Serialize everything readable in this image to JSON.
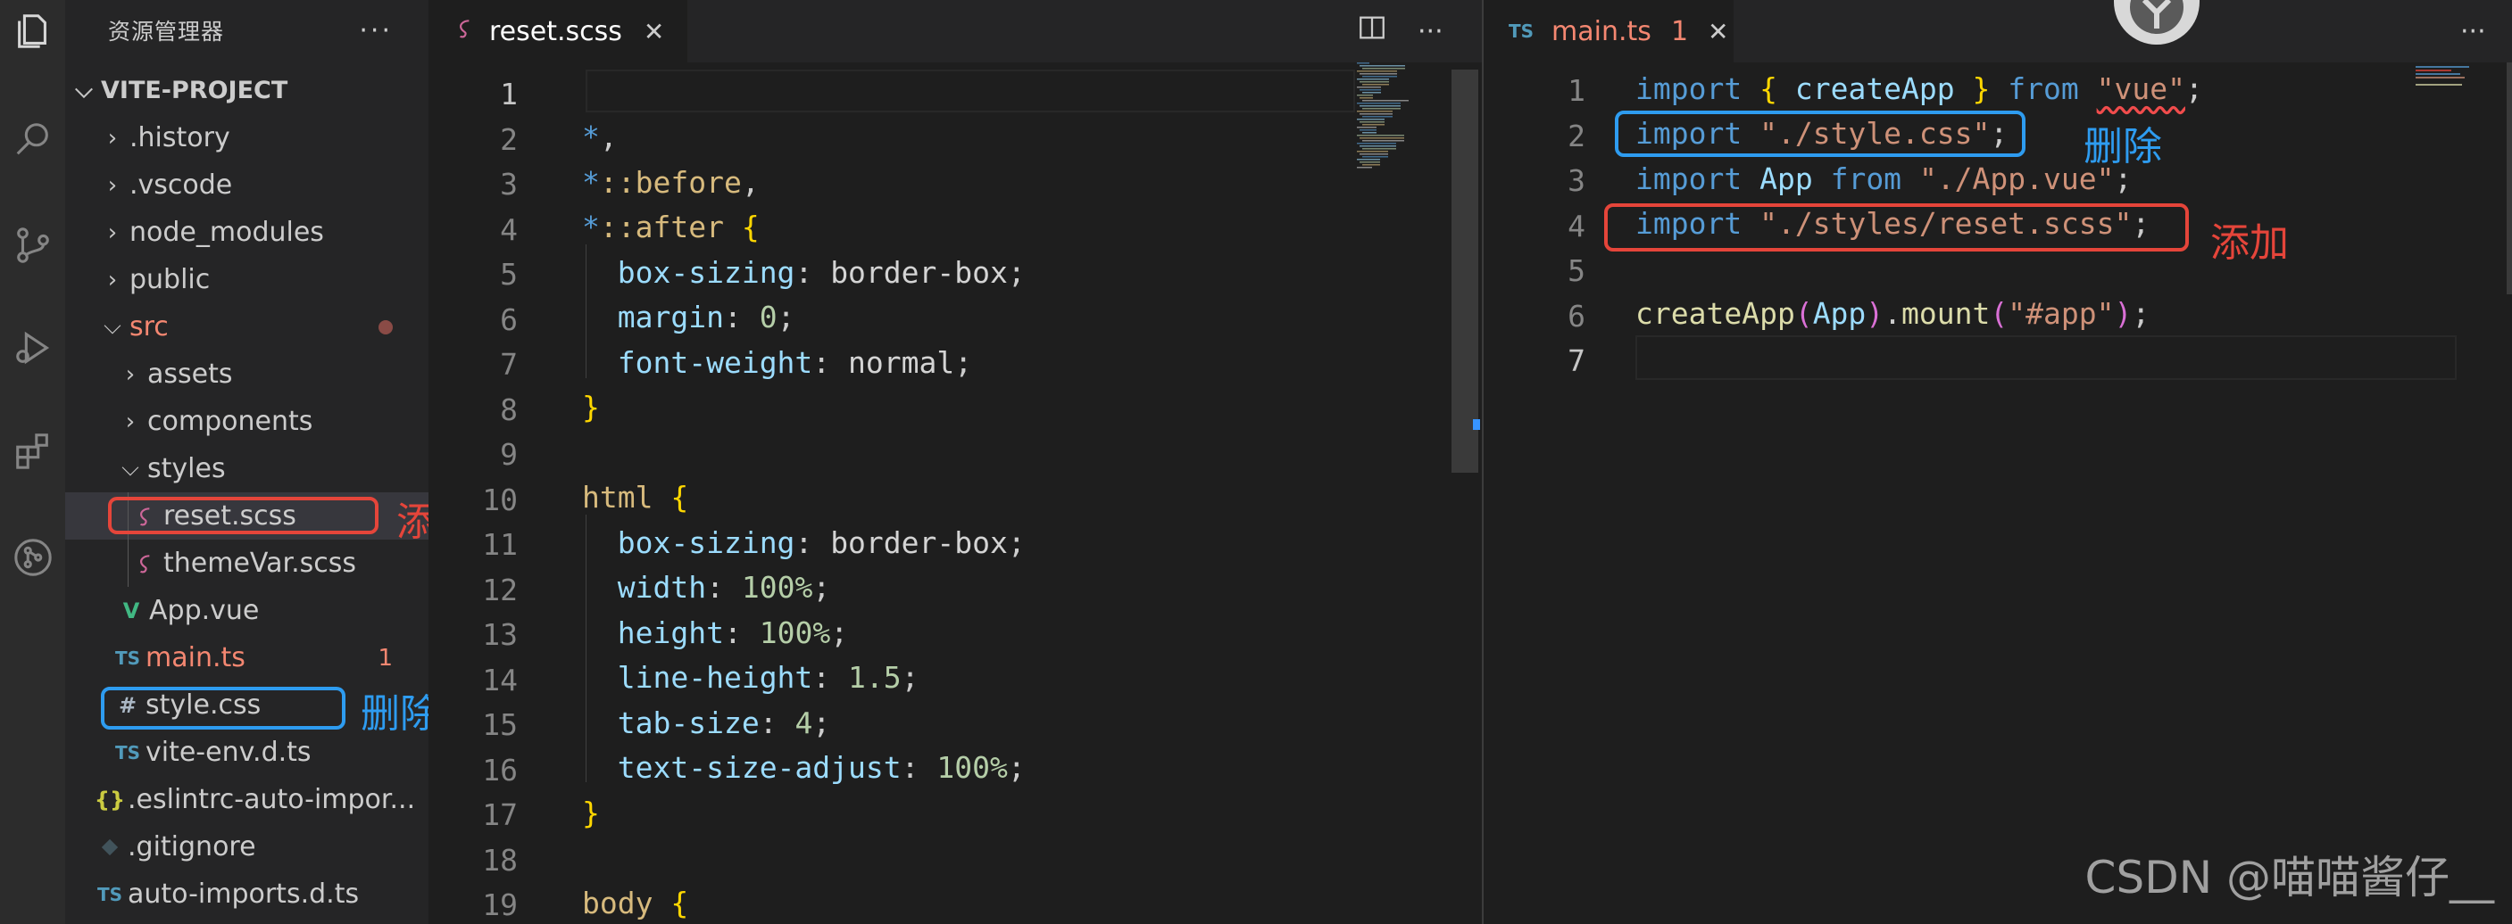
{
  "sidebar": {
    "title": "资源管理器",
    "more": "···",
    "tree": [
      {
        "label": "VITE-PROJECT",
        "kind": "root"
      },
      {
        "label": ".history"
      },
      {
        "label": ".vscode"
      },
      {
        "label": "node_modules"
      },
      {
        "label": "public"
      },
      {
        "label": "src"
      },
      {
        "label": "assets"
      },
      {
        "label": "components"
      },
      {
        "label": "styles"
      },
      {
        "label": "reset.scss"
      },
      {
        "label": "themeVar.scss"
      },
      {
        "label": "App.vue"
      },
      {
        "label": "main.ts",
        "badge": "1"
      },
      {
        "label": "style.css"
      },
      {
        "label": "vite-env.d.ts"
      },
      {
        "label": ".eslintrc-auto-impor..."
      },
      {
        "label": ".gitignore"
      },
      {
        "label": "auto-imports.d.ts"
      }
    ],
    "icons": {
      "ts": "TS",
      "css": "#",
      "json": "{}",
      "vue": "V"
    }
  },
  "annotations": {
    "add": "添加",
    "delete": "删除"
  },
  "editor_left": {
    "tab_label": "reset.scss",
    "tab_close": "✕",
    "more": "···",
    "line_numbers": [
      "1",
      "2",
      "3",
      "4",
      "5",
      "6",
      "7",
      "8",
      "9",
      "10",
      "11",
      "12",
      "13",
      "14",
      "15",
      "16",
      "17",
      "18",
      "19"
    ],
    "lines": [
      "",
      "*,",
      "*::before,",
      "*::after {",
      "  box-sizing: border-box;",
      "  margin: 0;",
      "  font-weight: normal;",
      "}",
      "",
      "html {",
      "  box-sizing: border-box;",
      "  width: 100%;",
      "  height: 100%;",
      "  line-height: 1.5;",
      "  tab-size: 4;",
      "  text-size-adjust: 100%;",
      "}",
      "",
      "body {"
    ]
  },
  "editor_right": {
    "tab_icon": "TS",
    "tab_label": "main.ts",
    "tab_badge": "1",
    "tab_close": "✕",
    "more": "···",
    "line_numbers": [
      "1",
      "2",
      "3",
      "4",
      "5",
      "6",
      "7"
    ],
    "lines": [
      "import { createApp } from \"vue\";",
      "import \"./style.css\";",
      "import App from \"./App.vue\";",
      "import \"./styles/reset.scss\";",
      "",
      "createApp(App).mount(\"#app\");",
      ""
    ]
  },
  "watermark": "CSDN @喵喵酱仔__",
  "colors": {
    "annotation_red": "#e5453a",
    "annotation_blue": "#2e9cf0"
  }
}
